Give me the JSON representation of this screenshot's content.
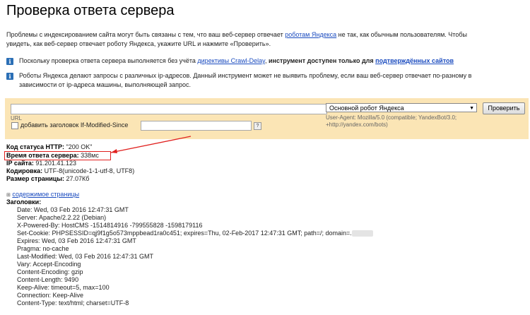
{
  "page": {
    "title": "Проверка ответа сервера",
    "intro": {
      "text1": "Проблемы с индексированием сайта могут быть связаны с тем, что ваш веб-сервер отвечает ",
      "link": "роботам Яндекса",
      "text2": " не так, как обычным пользователям. Чтобы",
      "line2": "увидеть, как веб-сервер отвечает роботу Яндекса, укажите URL и нажмите «Проверить»."
    },
    "note1": {
      "text1": "Поскольку проверка ответа сервера выполняется без учёта ",
      "link1": "директивы Crawl-Delay",
      "text2": ", ",
      "bold": "инструмент доступен только для ",
      "link2": "подтверждённых сайтов"
    },
    "note2": {
      "line1": "Роботы Яндекса делают запросы с различных ip-адресов. Данный инструмент может не выявить проблему, если ваш веб-сервер отвечает по-разному в",
      "line2": "зависимости от ip-адреса машины, выполняющей запрос."
    }
  },
  "form": {
    "url_label": "URL",
    "checkbox_label": "добавить заголовок If-Modified-Since",
    "help": "?",
    "robot_select": "Основной робот Яндекса",
    "user_agent_line1": "User-Agent: Mozilla/5.0 (compatible; YandexBot/3.0;",
    "user_agent_line2": "+http://yandex.com/bots)",
    "check_button": "Проверить"
  },
  "result": {
    "status_label": "Код статуса HTTP:",
    "status_value": " \"200 OK\"",
    "time_label": "Время ответа сервера:",
    "time_value": " 338мс",
    "ip_label": "IP сайта:",
    "ip_value": " 91.201.41.123",
    "enc_label": "Кодировка:",
    "enc_value": " UTF-8(unicode-1-1-utf-8, UTF8)",
    "size_label": "Размер страницы:",
    "size_value": " 27.07Кб",
    "content_toggle": "содержимое страницы",
    "headers_title": "Заголовки:",
    "headers": [
      "Date: Wed, 03 Feb 2016 12:47:31 GMT",
      "Server: Apache/2.2.22 (Debian)",
      "X-Powered-By: HostCMS -1514814916 -799555828 -1598179116",
      "Set-Cookie: PHPSESSID=qj9f1g5o573mppbead1ra0c451; expires=Thu, 02-Feb-2017 12:47:31 GMT; path=/; domain=.",
      "Expires: Wed, 03 Feb 2016 12:47:31 GMT",
      "Pragma: no-cache",
      "Last-Modified: Wed, 03 Feb 2016 12:47:31 GMT",
      "Vary: Accept-Encoding",
      "Content-Encoding: gzip",
      "Content-Length: 9490",
      "Keep-Alive: timeout=5, max=100",
      "Connection: Keep-Alive",
      "Content-Type: text/html; charset=UTF-8"
    ]
  },
  "colors": {
    "panel": "#fbe5b5",
    "link": "#1a4bbf",
    "highlight": "#e0201e",
    "info_icon": "#2b6fb6"
  }
}
